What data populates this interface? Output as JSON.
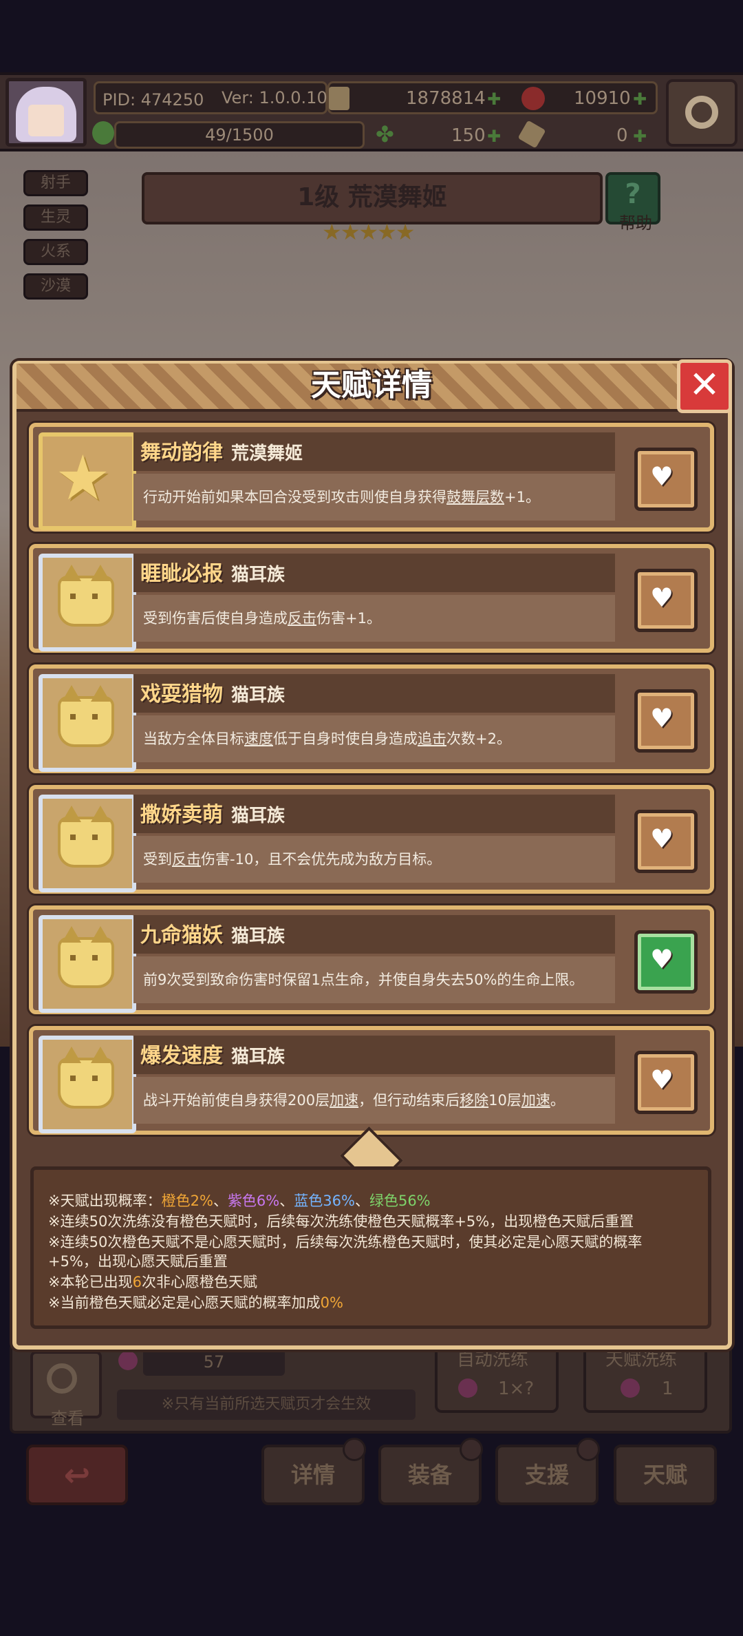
{
  "header": {
    "pid": "PID: 474250",
    "version": "Ver: 1.0.0.10",
    "gold": "1878814",
    "gems": "10910",
    "stamina": "49/1500",
    "clover": "150",
    "ticket": "0"
  },
  "character": {
    "tags": [
      "射手",
      "生灵",
      "火系",
      "沙漠"
    ],
    "title": "1级  荒漠舞姬",
    "stars": "★★★★★",
    "help_label": "帮助"
  },
  "modal": {
    "title": "天赋详情",
    "close_symbol": "✕",
    "talents": [
      {
        "name": "舞动韵律",
        "type": "荒漠舞姬",
        "desc_pre": "行动开始前如果本回合没受到攻击则使自身获得",
        "kw1": "鼓舞层数",
        "desc_mid": "+1。",
        "kw2": "",
        "desc_mid2": "",
        "kw3": "",
        "desc_post": "",
        "wished": false,
        "icon": "star-icon"
      },
      {
        "name": "睚眦必报",
        "type": "猫耳族",
        "desc_pre": "受到伤害后使自身造成",
        "kw1": "反击",
        "desc_mid": "伤害+1。",
        "kw2": "",
        "desc_mid2": "",
        "kw3": "",
        "desc_post": "",
        "wished": false,
        "icon": "cat-icon"
      },
      {
        "name": "戏耍猎物",
        "type": "猫耳族",
        "desc_pre": "当敌方全体目标",
        "kw1": "速度",
        "desc_mid": "低于自身时使自身造成",
        "kw2": "追击",
        "desc_mid2": "次数+2。",
        "kw3": "",
        "desc_post": "",
        "wished": false,
        "icon": "cat-icon"
      },
      {
        "name": "撒娇卖萌",
        "type": "猫耳族",
        "desc_pre": "受到",
        "kw1": "反击",
        "desc_mid": "伤害-10，且不会优先成为敌方目标。",
        "kw2": "",
        "desc_mid2": "",
        "kw3": "",
        "desc_post": "",
        "wished": false,
        "icon": "cat-icon"
      },
      {
        "name": "九命猫妖",
        "type": "猫耳族",
        "desc_pre": "前9次受到致命伤害时保留1点生命，并使自身失去50%的生命上限。",
        "kw1": "",
        "desc_mid": "",
        "kw2": "",
        "desc_mid2": "",
        "kw3": "",
        "desc_post": "",
        "wished": true,
        "icon": "cat-icon"
      },
      {
        "name": "爆发速度",
        "type": "猫耳族",
        "desc_pre": "战斗开始前使自身获得200层",
        "kw1": "加速",
        "desc_mid": "，但行动结束后",
        "kw2": "移除",
        "desc_mid2": "10层",
        "kw3": "加速",
        "desc_post": "。",
        "wished": false,
        "icon": "cat-icon"
      }
    ]
  },
  "info": {
    "l1_pre": "※天赋出现概率：",
    "orange": "橙色2%",
    "sep1": "、",
    "purple": "紫色6%",
    "sep2": "、",
    "blue": "蓝色36%",
    "sep3": "、",
    "green": "绿色56%",
    "l2": "※连续50次洗练没有橙色天赋时，后续每次洗练使橙色天赋概率+5%，出现橙色天赋后重置",
    "l3a": "※连续50次橙色天赋不是心愿天赋时，后续每次洗练橙色天赋时，使其必定是心愿天赋的概率",
    "l3b": "+5%，出现心愿天赋后重置",
    "l4_pre": "※本轮已出现",
    "l4_num": "6",
    "l4_post": "次非心愿橙色天赋",
    "l5_pre": "※当前橙色天赋必定是心愿天赋的概率加成",
    "l5_num": "0%"
  },
  "bottom": {
    "potion_count": "57",
    "view_label": "查看",
    "note": "※只有当前所选天赋页才会生效",
    "auto_wash": "自动洗练",
    "auto_wash_cost": "1×?",
    "talent_wash": "天赋洗练",
    "talent_wash_cost": "1",
    "nav": [
      "详情",
      "装备",
      "支援",
      "天赋"
    ],
    "back_symbol": "↩"
  },
  "colors": {
    "accent_gold": "#e0b670",
    "close_red": "#d83a3a",
    "wish_green": "#3aa34f"
  }
}
